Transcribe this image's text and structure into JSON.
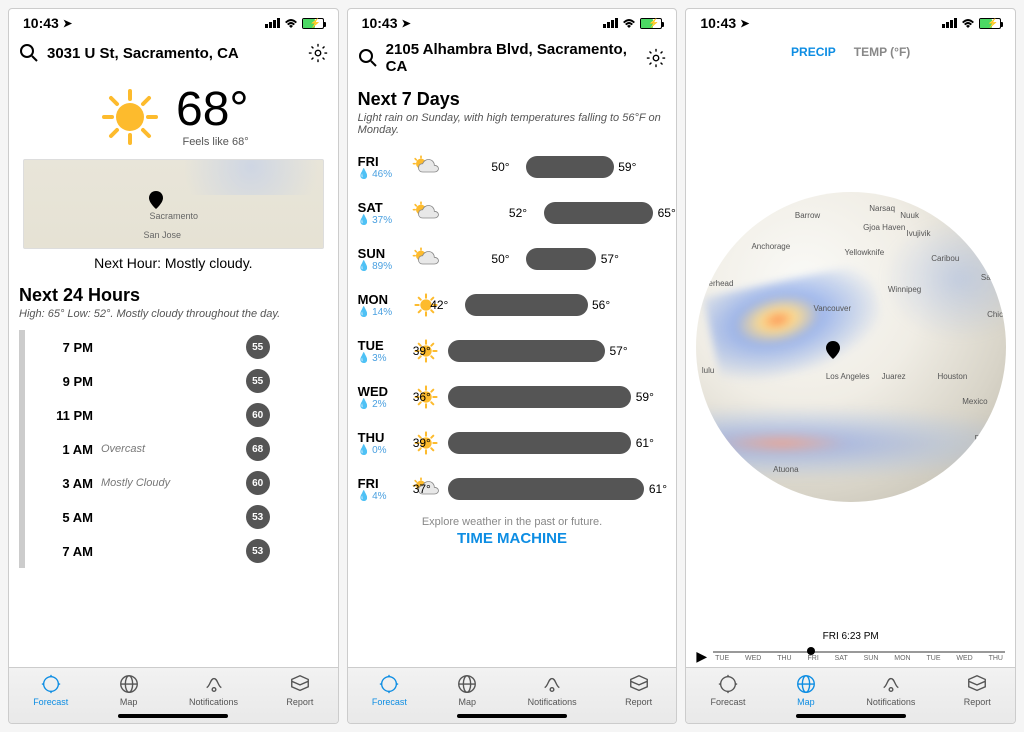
{
  "status": {
    "time": "10:43"
  },
  "screen1": {
    "location": "3031 U St, Sacramento, CA",
    "temp": "68°",
    "feels": "Feels like 68°",
    "nextHour": "Next Hour: Mostly cloudy.",
    "map": {
      "city1": "Sacramento",
      "city2": "San Jose"
    },
    "next24Title": "Next 24 Hours",
    "next24Sub": "High: 65° Low: 52°. Mostly cloudy throughout the day.",
    "hours": [
      {
        "time": "7 PM",
        "cond": "",
        "temp": "55"
      },
      {
        "time": "9 PM",
        "cond": "",
        "temp": "55"
      },
      {
        "time": "11 PM",
        "cond": "",
        "temp": "60"
      },
      {
        "time": "1 AM",
        "cond": "Overcast",
        "temp": "68"
      },
      {
        "time": "3 AM",
        "cond": "Mostly Cloudy",
        "temp": "60"
      },
      {
        "time": "5 AM",
        "cond": "",
        "temp": "53"
      },
      {
        "time": "7 AM",
        "cond": "",
        "temp": "53"
      }
    ],
    "tabs": {
      "forecast": "Forecast",
      "map": "Map",
      "notifications": "Notifications",
      "report": "Report"
    }
  },
  "screen2": {
    "location": "2105 Alhambra Blvd, Sacramento, CA",
    "title": "Next 7 Days",
    "subtitle": "Light rain on Sunday, with high temperatures falling to 56°F on Monday.",
    "days": [
      {
        "name": "FRI",
        "precip": "46%",
        "icon": "partly",
        "low": "50°",
        "high": "59°",
        "barL": 36,
        "barW": 40
      },
      {
        "name": "SAT",
        "precip": "37%",
        "icon": "partly",
        "low": "52°",
        "high": "65°",
        "barL": 44,
        "barW": 50
      },
      {
        "name": "SUN",
        "precip": "89%",
        "icon": "partly",
        "low": "50°",
        "high": "57°",
        "barL": 36,
        "barW": 32
      },
      {
        "name": "MON",
        "precip": "14%",
        "icon": "sun",
        "low": "42°",
        "high": "56°",
        "barL": 8,
        "barW": 56
      },
      {
        "name": "TUE",
        "precip": "3%",
        "icon": "sun",
        "low": "39°",
        "high": "57°",
        "barL": 0,
        "barW": 72
      },
      {
        "name": "WED",
        "precip": "2%",
        "icon": "sun",
        "low": "36°",
        "high": "59°",
        "barL": 0,
        "barW": 84
      },
      {
        "name": "THU",
        "precip": "0%",
        "icon": "sun",
        "low": "39°",
        "high": "61°",
        "barL": 0,
        "barW": 84
      },
      {
        "name": "FRI",
        "precip": "4%",
        "icon": "partly",
        "low": "37°",
        "high": "61°",
        "barL": 0,
        "barW": 90
      }
    ],
    "tmPrompt": "Explore weather in the past or future.",
    "tmLink": "TIME MACHINE",
    "tabs": {
      "forecast": "Forecast",
      "map": "Map",
      "notifications": "Notifications",
      "report": "Report"
    }
  },
  "screen3": {
    "tabPrecip": "PRECIP",
    "tabTemp": "TEMP (°F)",
    "cities": [
      "Barrow",
      "Narsaq",
      "Nuuk",
      "Anchorage",
      "Yellowknife",
      "Ivujivik",
      "Gjoa Haven",
      "Caribou",
      "Saint-Pierre",
      "Winnipeg",
      "Vancouver",
      "Chic",
      "Los Angeles",
      "Juarez",
      "Houston",
      "Mexico",
      "Puerto Ayora",
      "Atuona",
      "merhead",
      "lulu"
    ],
    "timeline": {
      "nowLabel": "FRI  6:23 PM",
      "labels": [
        "TUE",
        "WED",
        "THU",
        "FRI",
        "SAT",
        "SUN",
        "MON",
        "TUE",
        "WED",
        "THU"
      ]
    },
    "tabs": {
      "forecast": "Forecast",
      "map": "Map",
      "notifications": "Notifications",
      "report": "Report"
    }
  }
}
